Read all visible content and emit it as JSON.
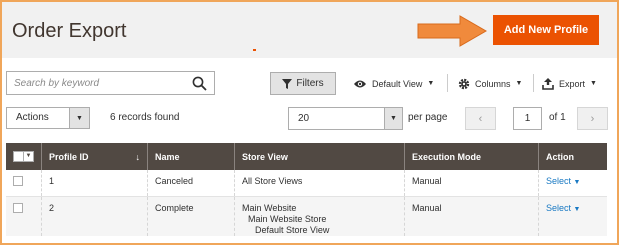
{
  "header": {
    "title": "Order Export",
    "add_button": "Add New Profile"
  },
  "search": {
    "placeholder": "Search by keyword"
  },
  "toolbar": {
    "filters": "Filters",
    "default_view": "Default View",
    "columns": "Columns",
    "export": "Export"
  },
  "actions": {
    "label": "Actions"
  },
  "records_found": "6 records found",
  "pager": {
    "per_page_value": "20",
    "per_page_label": "per page",
    "page_value": "1",
    "of_label": "of 1"
  },
  "table": {
    "headers": [
      "Profile ID",
      "Name",
      "Store View",
      "Execution Mode",
      "Action"
    ],
    "sort_indicator": "↓",
    "rows": [
      {
        "id": "1",
        "name": "Canceled",
        "store_view": [
          "All Store Views"
        ],
        "mode": "Manual",
        "action": "Select"
      },
      {
        "id": "2",
        "name": "Complete",
        "store_view": [
          "Main Website",
          "Main Website Store",
          "Default Store View"
        ],
        "mode": "Manual",
        "action": "Select"
      }
    ]
  },
  "colors": {
    "accent": "#eb5202",
    "header_bg": "#514943",
    "link": "#1979c3"
  }
}
